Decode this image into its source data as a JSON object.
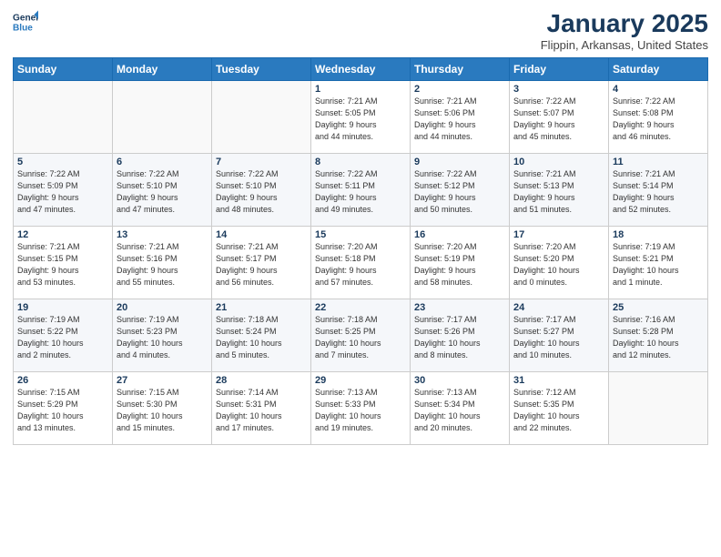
{
  "header": {
    "logo_line1": "General",
    "logo_line2": "Blue",
    "title": "January 2025",
    "subtitle": "Flippin, Arkansas, United States"
  },
  "weekdays": [
    "Sunday",
    "Monday",
    "Tuesday",
    "Wednesday",
    "Thursday",
    "Friday",
    "Saturday"
  ],
  "weeks": [
    [
      {
        "day": "",
        "info": ""
      },
      {
        "day": "",
        "info": ""
      },
      {
        "day": "",
        "info": ""
      },
      {
        "day": "1",
        "info": "Sunrise: 7:21 AM\nSunset: 5:05 PM\nDaylight: 9 hours\nand 44 minutes."
      },
      {
        "day": "2",
        "info": "Sunrise: 7:21 AM\nSunset: 5:06 PM\nDaylight: 9 hours\nand 44 minutes."
      },
      {
        "day": "3",
        "info": "Sunrise: 7:22 AM\nSunset: 5:07 PM\nDaylight: 9 hours\nand 45 minutes."
      },
      {
        "day": "4",
        "info": "Sunrise: 7:22 AM\nSunset: 5:08 PM\nDaylight: 9 hours\nand 46 minutes."
      }
    ],
    [
      {
        "day": "5",
        "info": "Sunrise: 7:22 AM\nSunset: 5:09 PM\nDaylight: 9 hours\nand 47 minutes."
      },
      {
        "day": "6",
        "info": "Sunrise: 7:22 AM\nSunset: 5:10 PM\nDaylight: 9 hours\nand 47 minutes."
      },
      {
        "day": "7",
        "info": "Sunrise: 7:22 AM\nSunset: 5:10 PM\nDaylight: 9 hours\nand 48 minutes."
      },
      {
        "day": "8",
        "info": "Sunrise: 7:22 AM\nSunset: 5:11 PM\nDaylight: 9 hours\nand 49 minutes."
      },
      {
        "day": "9",
        "info": "Sunrise: 7:22 AM\nSunset: 5:12 PM\nDaylight: 9 hours\nand 50 minutes."
      },
      {
        "day": "10",
        "info": "Sunrise: 7:21 AM\nSunset: 5:13 PM\nDaylight: 9 hours\nand 51 minutes."
      },
      {
        "day": "11",
        "info": "Sunrise: 7:21 AM\nSunset: 5:14 PM\nDaylight: 9 hours\nand 52 minutes."
      }
    ],
    [
      {
        "day": "12",
        "info": "Sunrise: 7:21 AM\nSunset: 5:15 PM\nDaylight: 9 hours\nand 53 minutes."
      },
      {
        "day": "13",
        "info": "Sunrise: 7:21 AM\nSunset: 5:16 PM\nDaylight: 9 hours\nand 55 minutes."
      },
      {
        "day": "14",
        "info": "Sunrise: 7:21 AM\nSunset: 5:17 PM\nDaylight: 9 hours\nand 56 minutes."
      },
      {
        "day": "15",
        "info": "Sunrise: 7:20 AM\nSunset: 5:18 PM\nDaylight: 9 hours\nand 57 minutes."
      },
      {
        "day": "16",
        "info": "Sunrise: 7:20 AM\nSunset: 5:19 PM\nDaylight: 9 hours\nand 58 minutes."
      },
      {
        "day": "17",
        "info": "Sunrise: 7:20 AM\nSunset: 5:20 PM\nDaylight: 10 hours\nand 0 minutes."
      },
      {
        "day": "18",
        "info": "Sunrise: 7:19 AM\nSunset: 5:21 PM\nDaylight: 10 hours\nand 1 minute."
      }
    ],
    [
      {
        "day": "19",
        "info": "Sunrise: 7:19 AM\nSunset: 5:22 PM\nDaylight: 10 hours\nand 2 minutes."
      },
      {
        "day": "20",
        "info": "Sunrise: 7:19 AM\nSunset: 5:23 PM\nDaylight: 10 hours\nand 4 minutes."
      },
      {
        "day": "21",
        "info": "Sunrise: 7:18 AM\nSunset: 5:24 PM\nDaylight: 10 hours\nand 5 minutes."
      },
      {
        "day": "22",
        "info": "Sunrise: 7:18 AM\nSunset: 5:25 PM\nDaylight: 10 hours\nand 7 minutes."
      },
      {
        "day": "23",
        "info": "Sunrise: 7:17 AM\nSunset: 5:26 PM\nDaylight: 10 hours\nand 8 minutes."
      },
      {
        "day": "24",
        "info": "Sunrise: 7:17 AM\nSunset: 5:27 PM\nDaylight: 10 hours\nand 10 minutes."
      },
      {
        "day": "25",
        "info": "Sunrise: 7:16 AM\nSunset: 5:28 PM\nDaylight: 10 hours\nand 12 minutes."
      }
    ],
    [
      {
        "day": "26",
        "info": "Sunrise: 7:15 AM\nSunset: 5:29 PM\nDaylight: 10 hours\nand 13 minutes."
      },
      {
        "day": "27",
        "info": "Sunrise: 7:15 AM\nSunset: 5:30 PM\nDaylight: 10 hours\nand 15 minutes."
      },
      {
        "day": "28",
        "info": "Sunrise: 7:14 AM\nSunset: 5:31 PM\nDaylight: 10 hours\nand 17 minutes."
      },
      {
        "day": "29",
        "info": "Sunrise: 7:13 AM\nSunset: 5:33 PM\nDaylight: 10 hours\nand 19 minutes."
      },
      {
        "day": "30",
        "info": "Sunrise: 7:13 AM\nSunset: 5:34 PM\nDaylight: 10 hours\nand 20 minutes."
      },
      {
        "day": "31",
        "info": "Sunrise: 7:12 AM\nSunset: 5:35 PM\nDaylight: 10 hours\nand 22 minutes."
      },
      {
        "day": "",
        "info": ""
      }
    ]
  ]
}
